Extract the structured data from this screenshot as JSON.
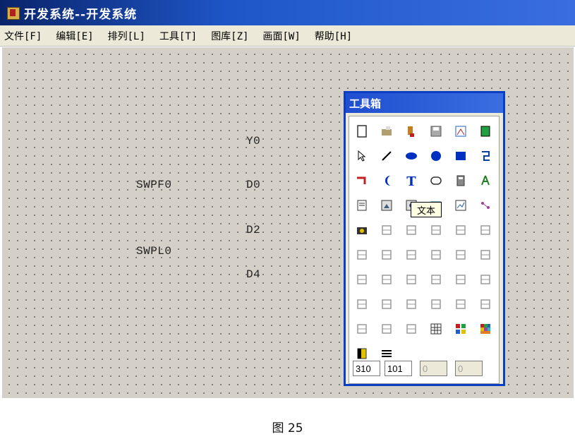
{
  "window": {
    "title": "开发系统--开发系统"
  },
  "menu": [
    {
      "label": "文件[F]"
    },
    {
      "label": "编辑[E]"
    },
    {
      "label": "排列[L]"
    },
    {
      "label": "工具[T]"
    },
    {
      "label": "图库[Z]"
    },
    {
      "label": "画面[W]"
    },
    {
      "label": "帮助[H]"
    }
  ],
  "canvas": {
    "labels": [
      "Y0",
      "SWPF0",
      "D0",
      "D2",
      "SWPL0",
      "D4"
    ]
  },
  "toolbox": {
    "title": "工具箱",
    "tooltip": "文本",
    "coords": [
      "310",
      "101",
      "0",
      "0"
    ],
    "tools": [
      "new-page-icon",
      "open-folder-icon",
      "paint-bucket-icon",
      "save-icon",
      "network-icon",
      "green-panel-icon",
      "pointer-icon",
      "line-icon",
      "ellipse-filled-icon",
      "circle-filled-icon",
      "rectangle-filled-icon",
      "polyline-icon",
      "pipe-icon",
      "arc-icon",
      "text-icon",
      "rounded-rect-icon",
      "calculator-icon",
      "alarm-icon",
      "notepad-icon",
      "picture-icon",
      "image-icon",
      "chart-icon",
      "trend-icon",
      "link-icon",
      "camera-icon",
      "undo-icon",
      "redo-icon",
      "group-icon",
      "copy-icon",
      "paste-icon",
      "align-left-icon",
      "align-center-icon",
      "align-right-icon",
      "align-top-icon",
      "align-middle-icon",
      "align-bottom-icon",
      "ungroup-icon",
      "bring-front-icon",
      "send-back-icon",
      "same-width-icon",
      "same-height-icon",
      "same-size-icon",
      "space-h-icon",
      "space-v-icon",
      "distribute-icon",
      "center-h-icon",
      "center-v-icon",
      "rotate-icon",
      "snap-icon",
      "dots-h-icon",
      "dots-v-icon",
      "grid-icon",
      "color-grid-icon",
      "palette-icon",
      "fill-pattern-icon",
      "line-style-icon"
    ],
    "colors": {
      "border": "#0a3fc4",
      "title_bg": "#1f4fd0"
    }
  },
  "caption": "图 25"
}
